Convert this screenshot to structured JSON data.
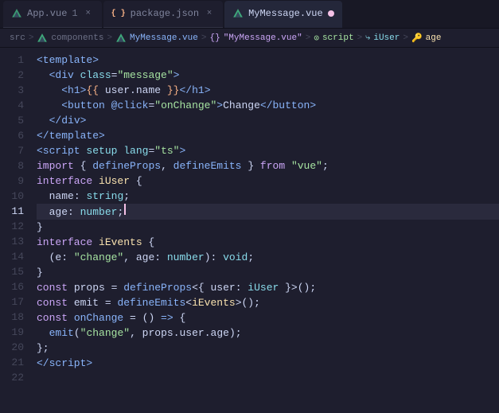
{
  "tabs": [
    {
      "id": "app-vue",
      "label": "App.vue",
      "number": "1",
      "icon": "vue",
      "active": false,
      "modified": false,
      "dot": false
    },
    {
      "id": "package-json",
      "label": "package.json",
      "icon": "json",
      "active": false,
      "modified": false,
      "dot": false
    },
    {
      "id": "mymessage-vue",
      "label": "MyMessage.vue",
      "icon": "vue",
      "active": true,
      "modified": true,
      "dot": true
    }
  ],
  "breadcrumb": {
    "src": "src",
    "sep1": ">",
    "components": "components",
    "sep2": ">",
    "file": "MyMessage.vue",
    "sep3": ">",
    "obj": "{}",
    "objLabel": "\"MyMessage.vue\"",
    "sep4": ">",
    "script": "script",
    "sep5": ">",
    "iUser": "iUser",
    "sep6": ">",
    "age": "age"
  },
  "lines": [
    {
      "num": 1,
      "active": false
    },
    {
      "num": 2,
      "active": false
    },
    {
      "num": 3,
      "active": false
    },
    {
      "num": 4,
      "active": false
    },
    {
      "num": 5,
      "active": false
    },
    {
      "num": 6,
      "active": false
    },
    {
      "num": 7,
      "active": false
    },
    {
      "num": 8,
      "active": false
    },
    {
      "num": 9,
      "active": false
    },
    {
      "num": 10,
      "active": false
    },
    {
      "num": 11,
      "active": true
    },
    {
      "num": 12,
      "active": false
    },
    {
      "num": 13,
      "active": false
    },
    {
      "num": 14,
      "active": false
    },
    {
      "num": 15,
      "active": false
    },
    {
      "num": 16,
      "active": false
    },
    {
      "num": 17,
      "active": false
    },
    {
      "num": 18,
      "active": false
    },
    {
      "num": 19,
      "active": false
    },
    {
      "num": 20,
      "active": false
    },
    {
      "num": 21,
      "active": false
    },
    {
      "num": 22,
      "active": false
    }
  ]
}
